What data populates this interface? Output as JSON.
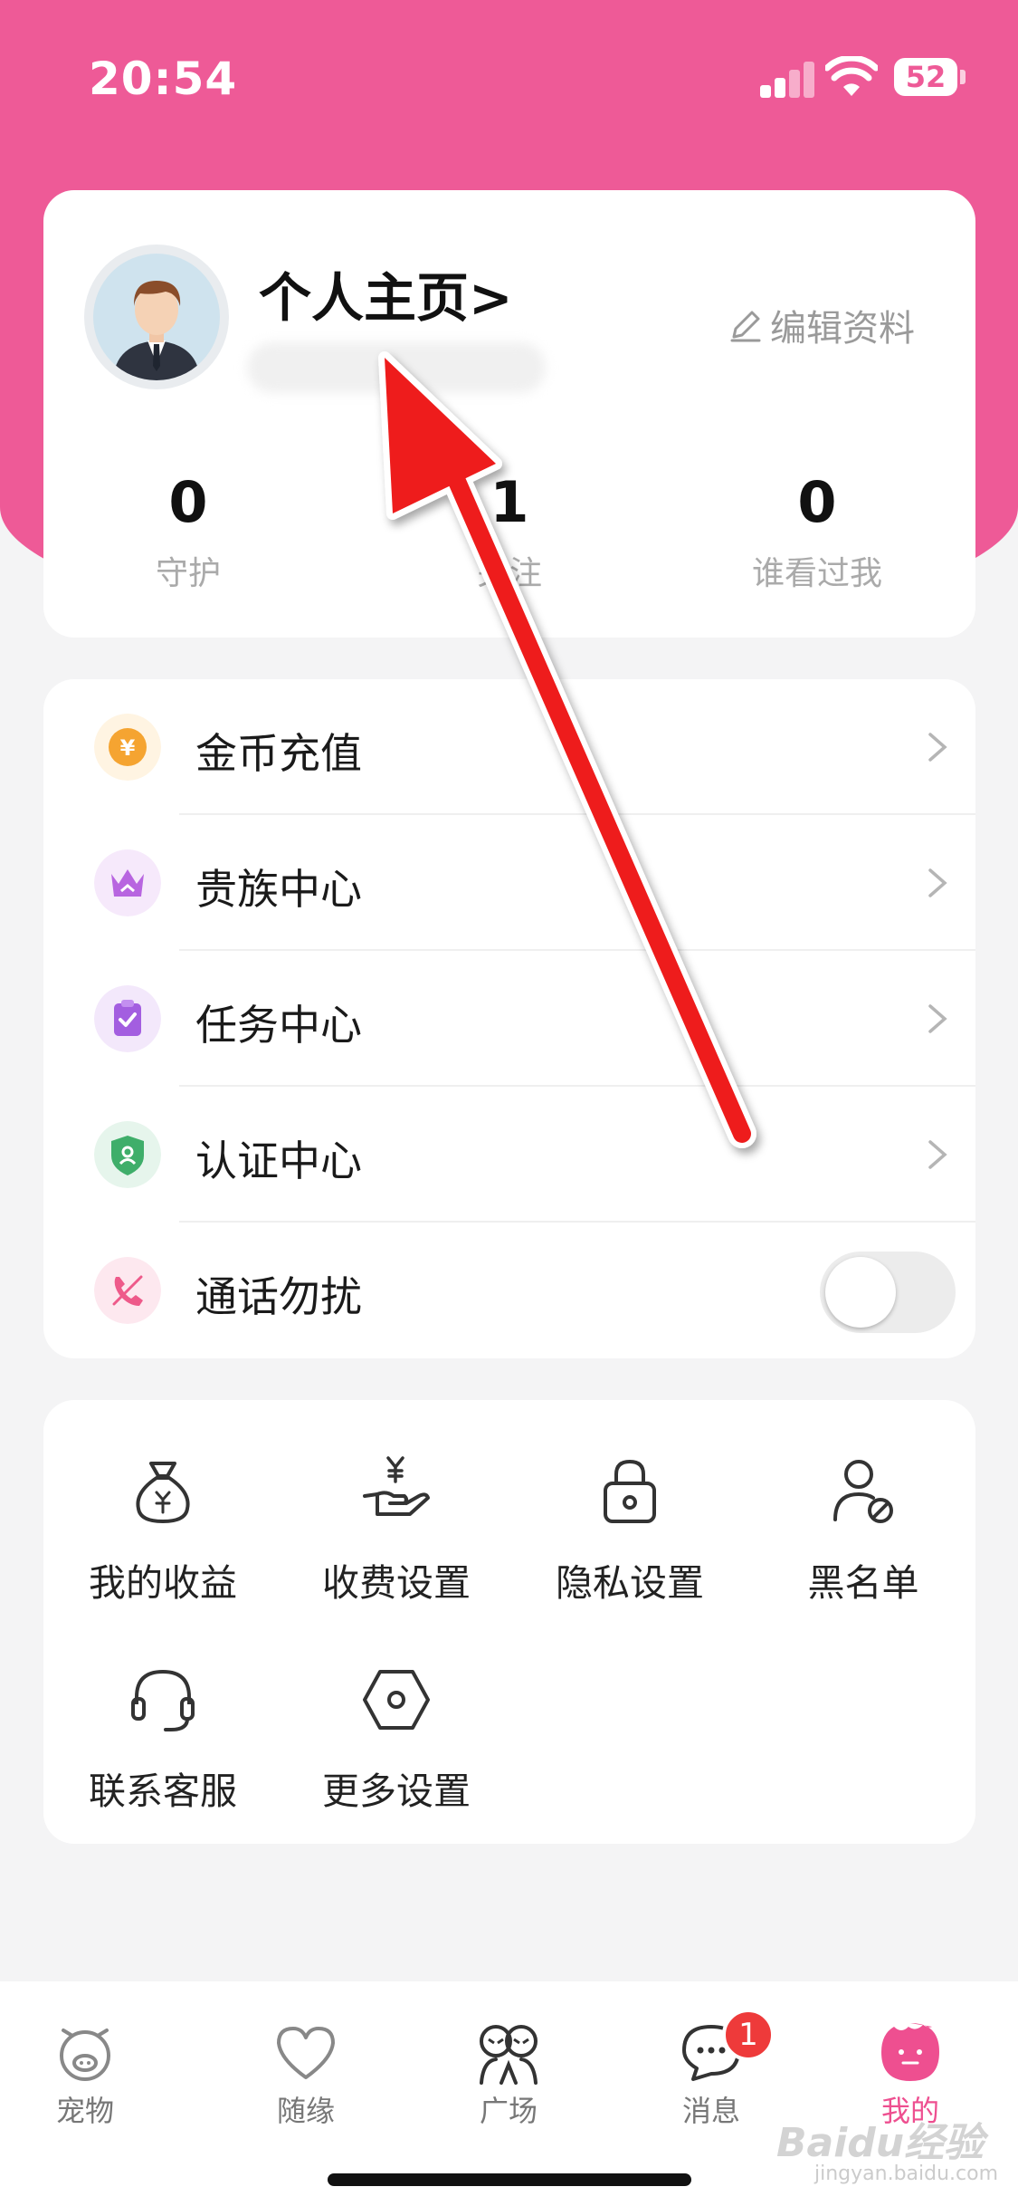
{
  "status_bar": {
    "time": "20:54",
    "battery": "52"
  },
  "profile": {
    "title": "个人主页>",
    "edit_label": "编辑资料",
    "stats": [
      {
        "value": "0",
        "label": "守护"
      },
      {
        "value": "1",
        "label": "关注"
      },
      {
        "value": "0",
        "label": "谁看过我"
      }
    ]
  },
  "menu": [
    {
      "label": "金币充值",
      "icon": "coin-icon"
    },
    {
      "label": "贵族中心",
      "icon": "crown-icon"
    },
    {
      "label": "任务中心",
      "icon": "task-icon"
    },
    {
      "label": "认证中心",
      "icon": "shield-icon"
    },
    {
      "label": "通话勿扰",
      "icon": "phone-mute-icon",
      "toggle": false
    }
  ],
  "tools": [
    {
      "label": "我的收益",
      "icon": "money-bag-icon"
    },
    {
      "label": "收费设置",
      "icon": "hand-coin-icon"
    },
    {
      "label": "隐私设置",
      "icon": "lock-icon"
    },
    {
      "label": "黑名单",
      "icon": "user-block-icon"
    },
    {
      "label": "联系客服",
      "icon": "headset-icon"
    },
    {
      "label": "更多设置",
      "icon": "hexagon-settings-icon"
    }
  ],
  "tabbar": {
    "items": [
      {
        "label": "宠物",
        "icon": "pig-icon"
      },
      {
        "label": "随缘",
        "icon": "heart-icon"
      },
      {
        "label": "广场",
        "icon": "faces-icon"
      },
      {
        "label": "消息",
        "icon": "chat-icon",
        "badge": "1"
      },
      {
        "label": "我的",
        "icon": "me-icon",
        "active": true
      }
    ]
  },
  "watermark": {
    "text": "Baidu经验",
    "sub": "jingyan.baidu.com"
  },
  "colors": {
    "accent": "#ee5a97",
    "tab_active": "#ee4f90",
    "badge": "#ee3a3a",
    "arrow": "#ee1c1c"
  }
}
